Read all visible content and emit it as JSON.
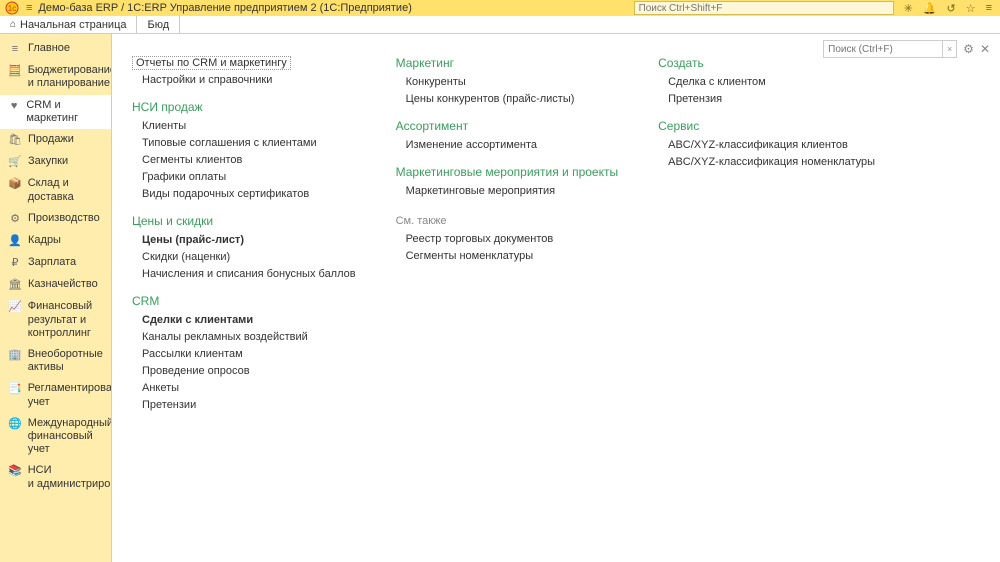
{
  "titlebar": {
    "title": "Демо-база ERP / 1C:ERP Управление предприятием 2  (1С:Предприятие)",
    "search_placeholder": "Поиск Ctrl+Shift+F"
  },
  "tabs": [
    {
      "label": "Начальная страница",
      "icon": "home"
    },
    {
      "label": "Бюд"
    }
  ],
  "sidebar": [
    {
      "icon": "≡",
      "label": "Главное"
    },
    {
      "icon": "🧮",
      "label": "Бюджетирование и планирование"
    },
    {
      "icon": "♥",
      "label": "CRM и маркетинг",
      "active": true
    },
    {
      "icon": "🛍",
      "label": "Продажи"
    },
    {
      "icon": "🛒",
      "label": "Закупки"
    },
    {
      "icon": "📦",
      "label": "Склад и доставка"
    },
    {
      "icon": "⚙",
      "label": "Производство"
    },
    {
      "icon": "👤",
      "label": "Кадры"
    },
    {
      "icon": "₽",
      "label": "Зарплата"
    },
    {
      "icon": "🏛",
      "label": "Казначейство"
    },
    {
      "icon": "📈",
      "label": "Финансовый результат и контроллинг"
    },
    {
      "icon": "🏢",
      "label": "Внеоборотные активы"
    },
    {
      "icon": "📑",
      "label": "Регламентированный учет"
    },
    {
      "icon": "🌐",
      "label": "Международный финансовый учет"
    },
    {
      "icon": "📚",
      "label": "НСИ и администрирование"
    }
  ],
  "panel_search_placeholder": "Поиск (Ctrl+F)",
  "col1": {
    "top": [
      {
        "text": "Отчеты по CRM и маркетингу",
        "selected": true
      },
      {
        "text": "Настройки и справочники"
      }
    ],
    "g1_title": "НСИ продаж",
    "g1": [
      "Клиенты",
      "Типовые соглашения с клиентами",
      "Сегменты клиентов",
      "Графики оплаты",
      "Виды подарочных сертификатов"
    ],
    "g2_title": "Цены и скидки",
    "g2": [
      {
        "text": "Цены (прайс-лист)",
        "bold": true
      },
      {
        "text": "Скидки (наценки)"
      },
      {
        "text": "Начисления и списания бонусных баллов"
      }
    ],
    "g3_title": "CRM",
    "g3": [
      {
        "text": "Сделки с клиентами",
        "bold": true
      },
      {
        "text": "Каналы рекламных воздействий"
      },
      {
        "text": "Рассылки клиентам"
      },
      {
        "text": "Проведение опросов"
      },
      {
        "text": "Анкеты"
      },
      {
        "text": "Претензии"
      }
    ]
  },
  "col2": {
    "g1_title": "Маркетинг",
    "g1": [
      "Конкуренты",
      "Цены конкурентов (прайс-листы)"
    ],
    "g2_title": "Ассортимент",
    "g2": [
      "Изменение ассортимента"
    ],
    "g3_title": "Маркетинговые мероприятия и проекты",
    "g3": [
      "Маркетинговые мероприятия"
    ],
    "seealso": "См. также",
    "sa": [
      "Реестр торговых документов",
      "Сегменты номенклатуры"
    ]
  },
  "col3": {
    "g1_title": "Создать",
    "g1": [
      "Сделка с клиентом",
      "Претензия"
    ],
    "g2_title": "Сервис",
    "g2": [
      "ABC/XYZ-классификация клиентов",
      "ABC/XYZ-классификация номенклатуры"
    ]
  }
}
